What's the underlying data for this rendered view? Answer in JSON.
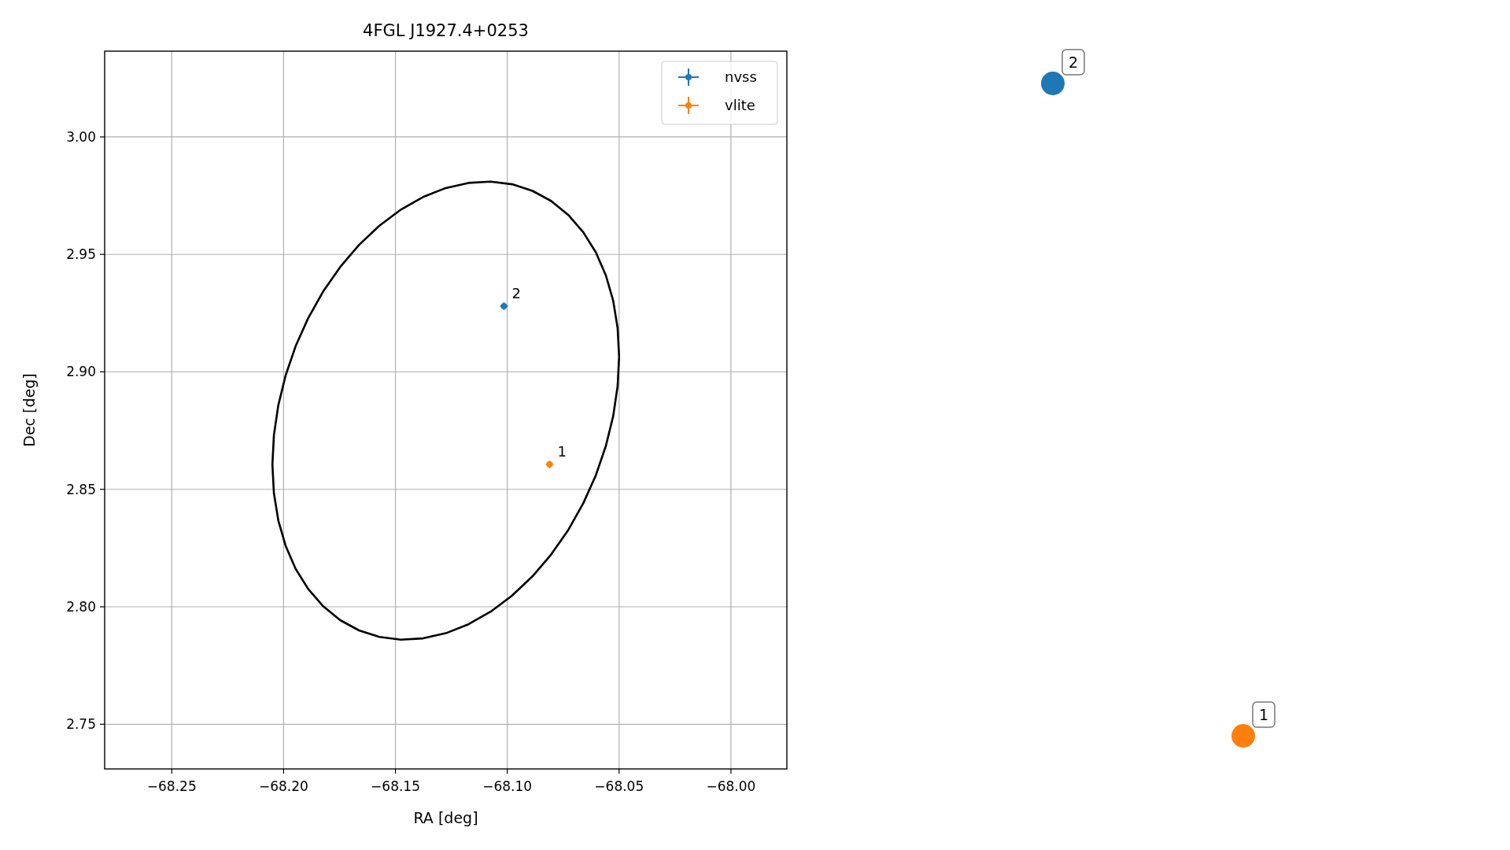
{
  "figure": {
    "chart_data": {
      "type": "scatter",
      "title": "4FGL J1927.4+0253",
      "xlabel": "RA [deg]",
      "ylabel": "Dec [deg]",
      "xlim": [
        -68.28,
        -67.975
      ],
      "ylim": [
        2.731,
        3.0365
      ],
      "xticks": [
        {
          "value": -68.25,
          "label": "−68.25"
        },
        {
          "value": -68.2,
          "label": "−68.20"
        },
        {
          "value": -68.15,
          "label": "−68.15"
        },
        {
          "value": -68.1,
          "label": "−68.10"
        },
        {
          "value": -68.05,
          "label": "−68.05"
        },
        {
          "value": -68.0,
          "label": "−68.00"
        }
      ],
      "yticks": [
        {
          "value": 2.75,
          "label": "2.75"
        },
        {
          "value": 2.8,
          "label": "2.80"
        },
        {
          "value": 2.85,
          "label": "2.85"
        },
        {
          "value": 2.9,
          "label": "2.90"
        },
        {
          "value": 2.95,
          "label": "2.95"
        },
        {
          "value": 3.0,
          "label": "3.00"
        }
      ],
      "series": [
        {
          "name": "nvss",
          "color": "#1f77b4",
          "x": [
            -68.1015
          ],
          "values": [
            2.928
          ]
        },
        {
          "name": "vlite",
          "color": "#ff7f0e",
          "x": [
            -68.0811
          ],
          "values": [
            2.8606
          ]
        }
      ],
      "annotations": [
        "2",
        "1"
      ],
      "grid": true,
      "legend": "upper right"
    },
    "markers": [
      {
        "label": "2",
        "color": "#1f77b4"
      },
      {
        "label": "1",
        "color": "#ff7f0e"
      }
    ]
  }
}
